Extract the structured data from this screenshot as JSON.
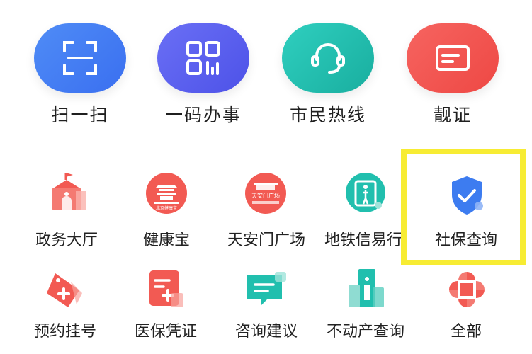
{
  "top_services": [
    {
      "label": "扫一扫",
      "icon": "scan-icon",
      "color": "#3e7bf1"
    },
    {
      "label": "一码办事",
      "icon": "qr-code-icon",
      "color": "#5b5ef0"
    },
    {
      "label": "市民热线",
      "icon": "headset-icon",
      "color": "#1fc0b0"
    },
    {
      "label": "靓证",
      "icon": "id-card-icon",
      "color": "#f2514e"
    }
  ],
  "row1": [
    {
      "label": "政务大厅",
      "icon": "government-hall-icon"
    },
    {
      "label": "健康宝",
      "icon": "health-treasure-icon",
      "icon_text": "北京健康宝"
    },
    {
      "label": "天安门广场",
      "icon": "tiananmen-square-icon",
      "icon_text": "天安门广场"
    },
    {
      "label": "地铁信易行",
      "icon": "subway-gate-icon"
    },
    {
      "label": "社保查询",
      "icon": "shield-check-icon"
    }
  ],
  "row2": [
    {
      "label": "预约挂号",
      "icon": "medical-tag-icon"
    },
    {
      "label": "医保凭证",
      "icon": "medical-insurance-icon"
    },
    {
      "label": "咨询建议",
      "icon": "message-icon"
    },
    {
      "label": "不动产查询",
      "icon": "real-estate-icon"
    },
    {
      "label": "全部",
      "icon": "all-services-icon"
    }
  ],
  "colors": {
    "highlight": "#f7ec33",
    "icon_red": "#f25a53",
    "icon_teal": "#21bfae",
    "icon_blue": "#3d7cf0"
  }
}
